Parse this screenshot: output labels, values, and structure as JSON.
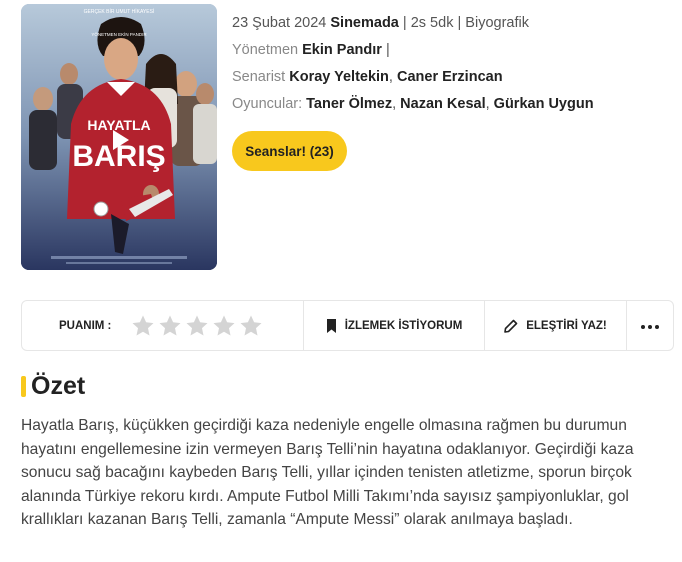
{
  "movie": {
    "release_date": "23 Şubat 2024",
    "status": "Sinemada",
    "duration": "2s 5dk",
    "genre": "Biyografik",
    "director_label": "Yönetmen",
    "directors": [
      "Ekin Pandır"
    ],
    "writer_label": "Senarist",
    "writers": [
      "Koray Yeltekin",
      "Caner Erzincan"
    ],
    "cast_label": "Oyuncular:",
    "cast": [
      "Taner Ölmez",
      "Nazan Kesal",
      "Gürkan Uygun"
    ],
    "sessions_button": "Seanslar! (23)"
  },
  "poster": {
    "tagline": "GERÇEK BİR UMUT HİKAYESİ",
    "title_line1": "HAYATLA",
    "title_line2": "BARIŞ",
    "director_credit": "YÖNETMEN EKİN PANDIR",
    "play_icon": "play-icon"
  },
  "actions": {
    "rating_label": "PUANIM :",
    "star_count": 5,
    "rating_value": 0,
    "watchlist_label": "İZLEMEK İSTİYORUM",
    "review_label": "ELEŞTİRİ YAZ!",
    "more_icon": "more-dots-icon"
  },
  "summary": {
    "title": "Özet",
    "text": "Hayatla Barış, küçükken geçirdiği kaza nedeniyle engelle olmasına rağmen bu durumun hayatını engellemesine izin vermeyen Barış Telli’nin hayatına odaklanıyor. Geçirdiği kaza sonucu sağ bacağını kaybeden Barış Telli, yıllar içinden tenisten atletizme, sporun birçok alanında Türkiye rekoru kırdı. Ampute Futbol Milli Takımı’nda sayısız şampiyonluklar, gol krallıkları kazanan Barış Telli, zamanla “Ampute Messi” olarak anılmaya başladı."
  },
  "colors": {
    "accent": "#f8c81d",
    "star_empty": "#d4d4d4"
  }
}
